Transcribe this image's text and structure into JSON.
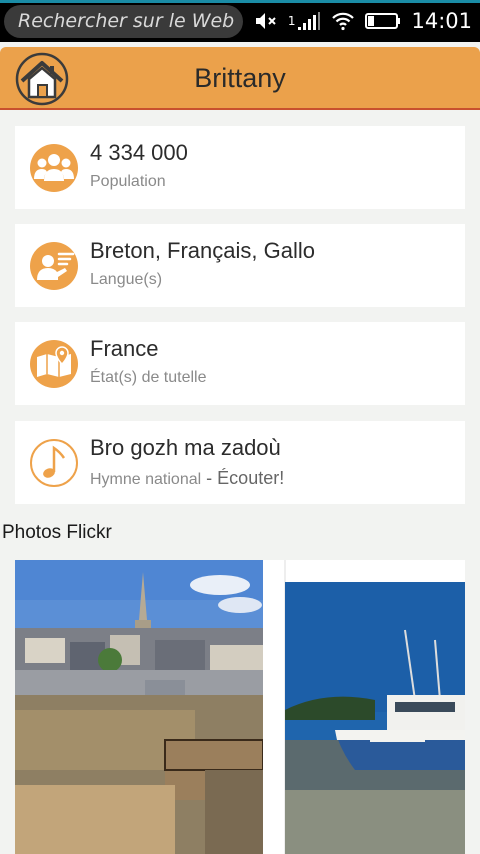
{
  "status_bar": {
    "search_placeholder": "Rechercher sur le Web",
    "sim_label": "1",
    "time": "14:01",
    "icons": [
      "muted-speaker-icon",
      "signal-icon",
      "wifi-icon",
      "battery-icon"
    ]
  },
  "header": {
    "title": "Brittany",
    "home_icon": "home-icon"
  },
  "cards": [
    {
      "value": "4 334 000",
      "label": "Population",
      "icon": "people-icon"
    },
    {
      "value": "Breton, Français, Gallo",
      "label": "Langue(s)",
      "icon": "speaker-person-icon"
    },
    {
      "value": "France",
      "label": "État(s) de tutelle",
      "icon": "map-pin-icon"
    },
    {
      "value": "Bro gozh ma zadoù",
      "label": "Hymne national",
      "link_separator": " - ",
      "link": "Écouter!",
      "icon": "music-note-icon"
    }
  ],
  "photos": {
    "title": "Photos Flickr"
  },
  "colors": {
    "header": "#eba14b",
    "accent_icon": "#eea24a",
    "status_accent": "#1a8ca6"
  }
}
